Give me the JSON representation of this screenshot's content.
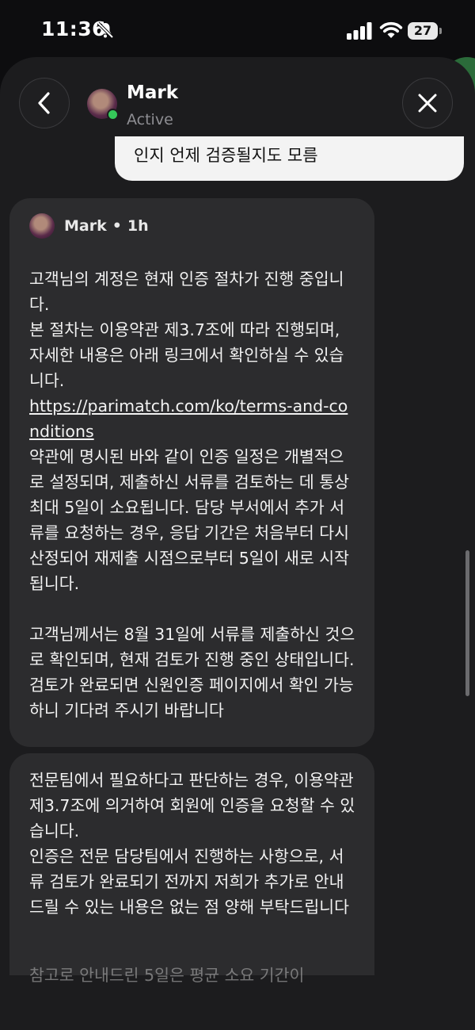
{
  "status_bar": {
    "time": "11:36",
    "battery": "27"
  },
  "header": {
    "contact_name": "Mark",
    "contact_status": "Active"
  },
  "messages": {
    "outgoing_partial": "인지 언제 검증될지도 모름",
    "card1": {
      "sender": "Mark",
      "time": "1h",
      "separator": "•",
      "p1": "고객님의 계정은 현재 인증 절차가 진행 중입니다.\n본 절차는 이용약관 제3.7조에 따라 진행되며, 자세한 내용은 아래 링크에서 확인하실 수 있습니다.",
      "link": "https://parimatch.com/ko/terms-and-conditions",
      "p2": "약관에 명시된 바와 같이 인증 일정은 개별적으로 설정되며, 제출하신 서류를 검토하는 데 통상 최대 5일이 소요됩니다. 담당 부서에서 추가 서류를 요청하는 경우, 응답 기간은 처음부터 다시 산정되어 재제출 시점으로부터 5일이 새로 시작됩니다.\n\n고객님께서는 8월 31일에 서류를 제출하신 것으로 확인되며, 현재 검토가 진행 중인 상태입니다. 검토가 완료되면 신원인증 페이지에서 확인 가능하니 기다려 주시기 바랍니다"
    },
    "card2": {
      "p1": "전문팀에서 필요하다고 판단하는 경우, 이용약관 제3.7조에 의거하여 회원에 인증을 요청할 수 있습니다.\n인증은 전문 담당팀에서 진행하는 사항으로, 서류 검토가 완료되기 전까지 저희가 추가로 안내드릴 수 있는 내용은 없는 점 양해 부탁드립니다",
      "cut_line": "참고로 안내드린 5일은 평균 소요 기간이"
    }
  },
  "icons": {
    "back": "chevron-left-icon",
    "close": "close-icon",
    "mute": "bell-slash-icon",
    "signal": "cellular-signal-icon",
    "wifi": "wifi-icon",
    "battery": "battery-icon"
  },
  "colors": {
    "online": "#35c759",
    "card_bg": "#2c2c2e",
    "sheet_bg": "#1c1c1e",
    "outgoing_bg": "#f3f3f3"
  }
}
